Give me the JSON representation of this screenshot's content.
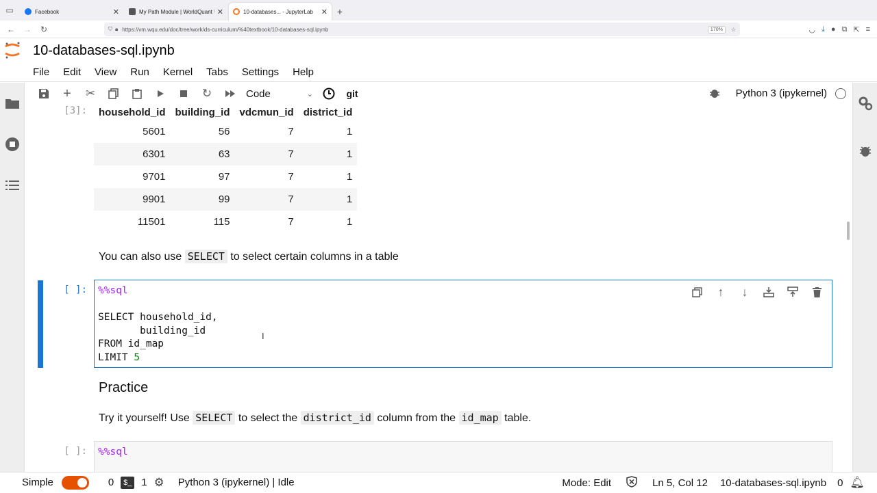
{
  "browser": {
    "tabs": [
      {
        "title": "Facebook",
        "color": "#1877f2"
      },
      {
        "title": "My Path Module | WorldQuant U",
        "color": "#555555"
      },
      {
        "title": "10-databases... - JupyterLab",
        "color": "#f37726"
      }
    ],
    "url": "https://vm.wqu.edu/doc/tree/work/ds-curriculum/%40textbook/10-databases-sql.ipynb",
    "zoom": "170%"
  },
  "jupyter": {
    "doc_title": "10-databases-sql.ipynb",
    "menu": [
      "File",
      "Edit",
      "View",
      "Run",
      "Kernel",
      "Tabs",
      "Settings",
      "Help"
    ],
    "toolbar": {
      "cell_type": "Code",
      "git_label": "git",
      "kernel": "Python 3 (ipykernel)"
    }
  },
  "notebook": {
    "output_prompt": "[3]:",
    "table": {
      "columns": [
        "household_id",
        "building_id",
        "vdcmun_id",
        "district_id"
      ],
      "rows": [
        [
          "5601",
          "56",
          "7",
          "1"
        ],
        [
          "6301",
          "63",
          "7",
          "1"
        ],
        [
          "9701",
          "97",
          "7",
          "1"
        ],
        [
          "9901",
          "99",
          "7",
          "1"
        ],
        [
          "11501",
          "115",
          "7",
          "1"
        ]
      ]
    },
    "md1": {
      "before": "You can also use ",
      "code": "SELECT",
      "after": " to select certain columns in a table"
    },
    "cell1": {
      "prompt": "[ ]:",
      "magic": "%%sql",
      "line1": "SELECT household_id,",
      "line2": "       building_id",
      "line3": "FROM id_map",
      "line4_kw": "LIMIT ",
      "line4_num": "5"
    },
    "practice_heading": "Practice",
    "md2": {
      "t1": "Try it yourself! Use ",
      "c1": "SELECT",
      "t2": " to select the ",
      "c2": "district_id",
      "t3": " column from the ",
      "c3": "id_map",
      "t4": " table."
    },
    "cell2": {
      "prompt": "[ ]:",
      "magic": "%%sql"
    }
  },
  "status": {
    "mode_label": "Simple",
    "count1": "0",
    "count2": "1",
    "kernel_status": "Python 3 (ipykernel) | Idle",
    "mode": "Mode: Edit",
    "position": "Ln 5, Col 12",
    "filename": "10-databases-sql.ipynb",
    "notifications": "0"
  },
  "colors": {
    "accent": "#1976d2",
    "jupyter_orange": "#f37726",
    "toggle": "#e65100"
  }
}
